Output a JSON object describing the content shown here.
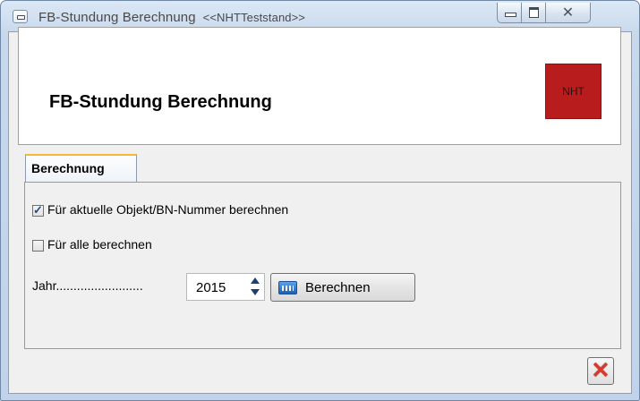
{
  "window": {
    "title": "FB-Stundung Berechnung",
    "subtitle": "<<NHTTeststand>>",
    "minimize_icon": "minimize-icon",
    "maximize_icon": "maximize-icon",
    "close_glyph": "☒"
  },
  "header": {
    "title": "FB-Stundung Berechnung",
    "logo_text": "NHT",
    "logo_color": "#b81c1c"
  },
  "tabs": [
    {
      "label": "Berechnung",
      "active": true
    }
  ],
  "options": {
    "current_object": {
      "label": "Für aktuelle Objekt/BN-Nummer berechnen",
      "checked": true
    },
    "all": {
      "label": "Für alle berechnen",
      "checked": false
    }
  },
  "year": {
    "label": "Jahr.........................",
    "value": "2015"
  },
  "actions": {
    "calculate_label": "Berechnen",
    "calculate_icon": "calculator-icon",
    "close_glyph": "✕",
    "close_icon": "close-red-x-icon"
  },
  "colors": {
    "accent_tab": "#f7b73b",
    "close_red": "#d83a2c"
  }
}
